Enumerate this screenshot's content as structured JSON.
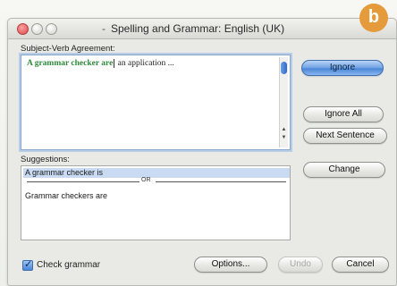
{
  "badge": {
    "letter": "b",
    "color": "#e59a3b"
  },
  "window": {
    "title": "Spelling and Grammar: English (UK)"
  },
  "sentence": {
    "label": "Subject-Verb Agreement:",
    "error_text": "A grammar checker are",
    "rest_text": " an application ..."
  },
  "suggestions": {
    "label": "Suggestions:",
    "items": [
      "A grammar checker is",
      "Grammar checkers are"
    ],
    "separator": "OR"
  },
  "buttons": {
    "ignore": "Ignore",
    "ignore_all": "Ignore All",
    "next_sentence": "Next Sentence",
    "change": "Change",
    "options": "Options...",
    "undo": "Undo",
    "cancel": "Cancel"
  },
  "check_grammar": {
    "label": "Check grammar",
    "checked": true
  },
  "icons": {
    "checkbox": "checkmark-icon",
    "scroll_up": "arrow-up-icon",
    "scroll_down": "arrow-down-icon"
  }
}
